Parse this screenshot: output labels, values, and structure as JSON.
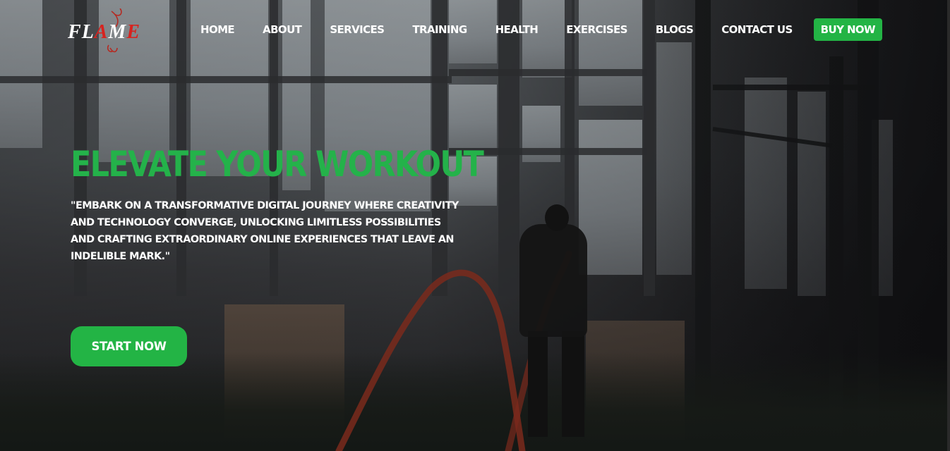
{
  "brand": {
    "logo_letters": [
      {
        "t": "F",
        "c": "w"
      },
      {
        "t": "L",
        "c": "w"
      },
      {
        "t": "A",
        "c": "r"
      },
      {
        "t": "M",
        "c": "w"
      },
      {
        "t": "E",
        "c": "r"
      }
    ],
    "colors": {
      "accent": "#23b445",
      "logo_red": "#d7231f",
      "text": "#ffffff"
    }
  },
  "nav": {
    "home": "HOME",
    "about": "ABOUT",
    "services": "SERVICES",
    "training": "TRAINING",
    "health": "HEALTH",
    "exercises": "EXERCISES",
    "blogs": "BLOGS",
    "contact": "CONTACT US",
    "buy": "BUY NOW"
  },
  "hero": {
    "headline": "ELEVATE YOUR WORKOUT",
    "tagline": "\"EMBARK ON A TRANSFORMATIVE DIGITAL JOURNEY WHERE CREATIVITY AND TECHNOLOGY CONVERGE, UNLOCKING LIMITLESS POSSIBILITIES AND CRAFTING EXTRAORDINARY ONLINE EXPERIENCES THAT LEAVE AN INDELIBLE MARK.\"",
    "cta": "START NOW"
  }
}
